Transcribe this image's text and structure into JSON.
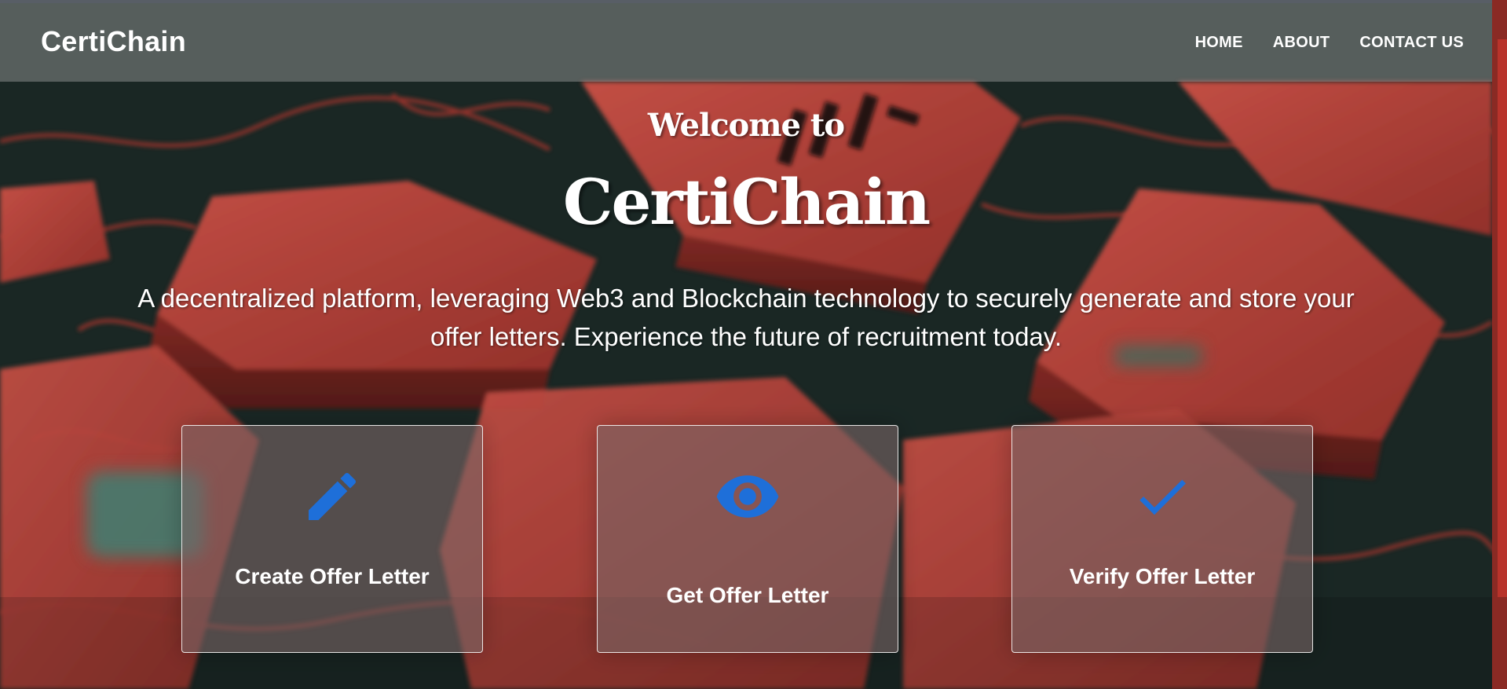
{
  "navbar": {
    "brand": "CertiChain",
    "links": [
      {
        "label": "HOME"
      },
      {
        "label": "ABOUT"
      },
      {
        "label": "CONTACT US"
      }
    ]
  },
  "hero": {
    "welcome": "Welcome to",
    "title": "CertiChain",
    "description": "A decentralized platform, leveraging Web3 and Blockchain technology to securely generate and store your offer letters. Experience the future of recruitment today."
  },
  "cards": [
    {
      "label": "Create Offer Letter",
      "icon": "pencil-icon"
    },
    {
      "label": "Get Offer Letter",
      "icon": "eye-icon"
    },
    {
      "label": "Verify Offer Letter",
      "icon": "checkmark-icon"
    }
  ],
  "colors": {
    "icon_blue": "#1e6fd9",
    "scroll_accent": "#b8332b",
    "brick_red": "#c4463d"
  }
}
